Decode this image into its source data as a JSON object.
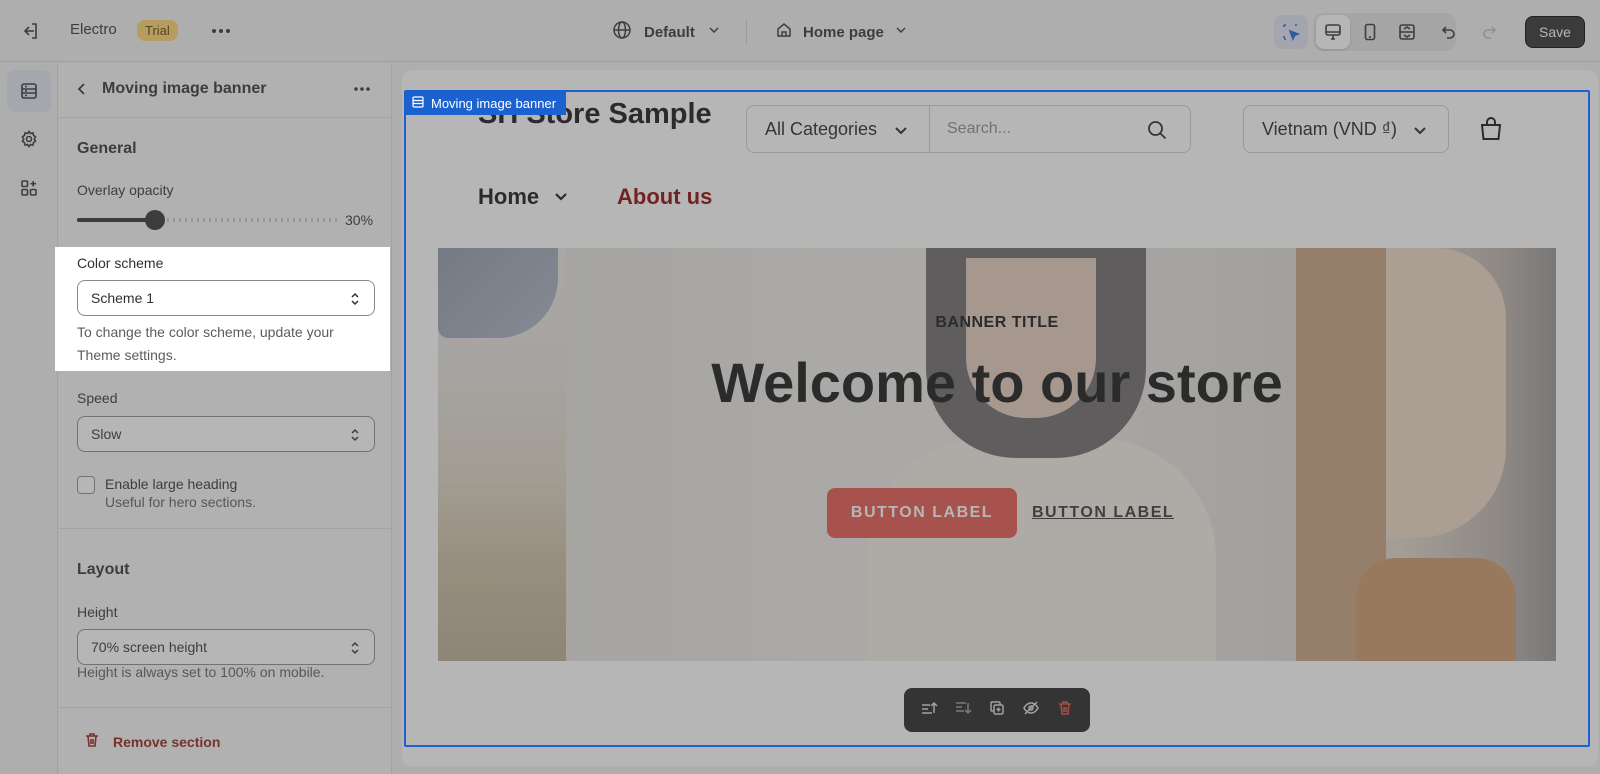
{
  "topbar": {
    "app_name": "Electro",
    "badge": "Trial",
    "theme_label": "Default",
    "page_label": "Home page",
    "save_label": "Save"
  },
  "panel": {
    "title": "Moving image banner",
    "general_heading": "General",
    "overlay_label": "Overlay opacity",
    "overlay_value": "30%",
    "overlay_fraction": 0.3,
    "color_scheme_label": "Color scheme",
    "color_scheme_value": "Scheme 1",
    "color_scheme_help": "To change the color scheme, update your Theme settings.",
    "speed_label": "Speed",
    "speed_value": "Slow",
    "large_heading_label": "Enable large heading",
    "large_heading_help": "Useful for hero sections.",
    "layout_heading": "Layout",
    "height_label": "Height",
    "height_value": "70% screen height",
    "height_help": "Height is always set to 100% on mobile.",
    "remove_label": "Remove section"
  },
  "preview": {
    "selected_tag": "Moving image banner",
    "logo": "SH Store Sample",
    "categories": "All Categories",
    "search_placeholder": "Search...",
    "currency": "Vietnam (VND ₫)",
    "nav": [
      "Home",
      "About us"
    ],
    "banner_title": "BANNER TITLE",
    "banner_heading": "Welcome to our store",
    "button_primary": "BUTTON LABEL",
    "button_secondary": "BUTTON LABEL"
  },
  "colors": {
    "accent": "#1b62d0",
    "save": "#2b2b2b",
    "remove": "#8e1f0b",
    "trial_badge": "#ffd56a",
    "about_link": "#8b0000",
    "button_primary": "#e5534b"
  },
  "icons": {
    "exit": "exit-icon",
    "more": "more-horizontal-icon",
    "globe": "globe-icon",
    "home": "home-icon",
    "inspect": "inspect-icon",
    "desktop": "desktop-icon",
    "mobile": "mobile-icon",
    "fullwidth": "fullwidth-icon",
    "undo": "undo-icon",
    "redo": "redo-icon",
    "sections": "sections-icon",
    "settings": "gear-icon",
    "apps": "apps-icon",
    "back": "chevron-left-icon",
    "search": "search-icon",
    "cart": "cart-icon",
    "trash": "trash-icon"
  }
}
